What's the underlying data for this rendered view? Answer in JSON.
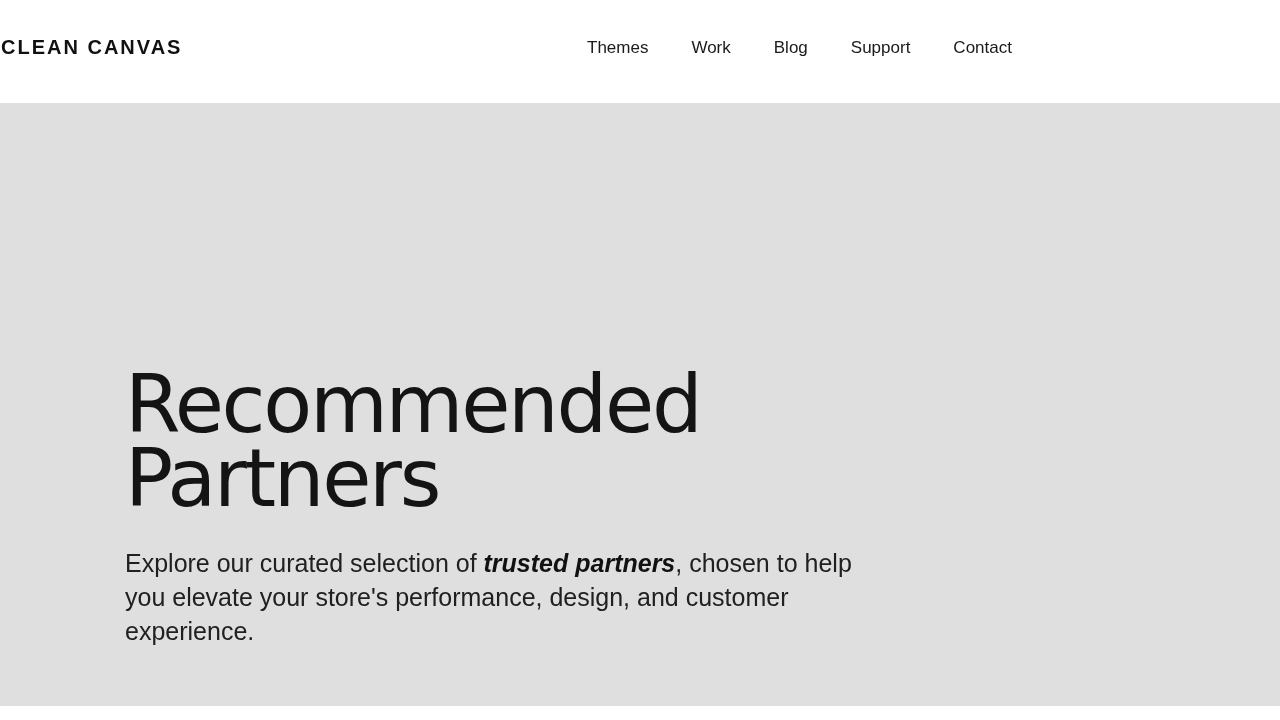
{
  "header": {
    "logo": "CLEAN CANVAS",
    "nav": [
      "Themes",
      "Work",
      "Blog",
      "Support",
      "Contact"
    ]
  },
  "hero": {
    "title": "Recommended Partners",
    "description": "Explore our curated selection of **trusted partners**, chosen to help you elevate your store's performance, design, and customer experience."
  }
}
